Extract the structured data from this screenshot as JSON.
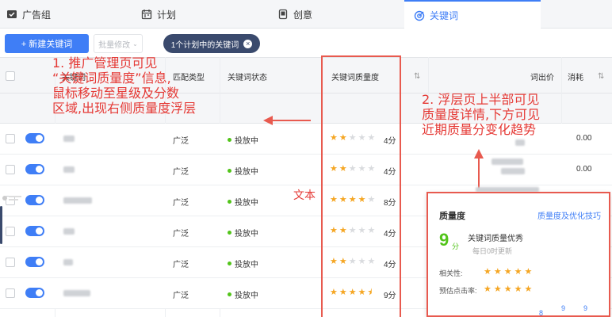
{
  "tabs": [
    {
      "label": "广告组",
      "icon": "folder-check-icon"
    },
    {
      "label": "计划",
      "icon": "calendar-icon"
    },
    {
      "label": "创意",
      "icon": "device-icon"
    },
    {
      "label": "关键词",
      "icon": "target-icon",
      "active": true
    }
  ],
  "toolbar": {
    "new_keyword": "+ 新建关键词",
    "batch_edit": "批量修改",
    "filter_chip": "1个计划中的关键词"
  },
  "table": {
    "headers": {
      "col_keyword": "关键词",
      "col_match": "匹配类型",
      "col_status": "关键词状态",
      "col_quality": "关键词质量度",
      "col_bid": "词出价",
      "col_cost": "消耗"
    },
    "rows": [
      {
        "match": "广泛",
        "status": "投放中",
        "stars": 2,
        "score": "4分",
        "cost": "0.00"
      },
      {
        "match": "广泛",
        "status": "投放中",
        "stars": 2,
        "score": "4分",
        "cost": "0.00"
      },
      {
        "match": "广泛",
        "status": "投放中",
        "stars": 4,
        "score": "8分",
        "cost": ""
      },
      {
        "match": "广泛",
        "status": "投放中",
        "stars": 2,
        "score": "4分",
        "cost": ""
      },
      {
        "match": "广泛",
        "status": "投放中",
        "stars": 2,
        "score": "4分",
        "cost": ""
      },
      {
        "match": "广泛",
        "status": "投放中",
        "stars": 4.5,
        "score": "9分",
        "cost": ""
      }
    ]
  },
  "annotations": {
    "note1": [
      "1. 推广管理页可见",
      "“关键词质量度”信息,",
      "鼠标移动至星级及分数",
      "区域,出现右侧质量度浮层"
    ],
    "note2": [
      "2. 浮层页上半部可见",
      "质量度详情,下方可见",
      "近期质量分变化趋势"
    ],
    "text_label": "文本"
  },
  "popover": {
    "title": "质量度",
    "link": "质量度及优化技巧",
    "score": "9",
    "unit": "分",
    "desc": "关键词质量优秀",
    "updated": "每日0时更新",
    "relevance_label": "相关性:",
    "relevance_stars": 5,
    "ctr_label": "预估点击率:",
    "ctr_stars": 5,
    "trend_values": [
      "8",
      "9",
      "9"
    ]
  },
  "colors": {
    "accent": "#3f7ef6",
    "annotation": "#e53935",
    "star": "#f5a623",
    "success": "#52c41a"
  }
}
